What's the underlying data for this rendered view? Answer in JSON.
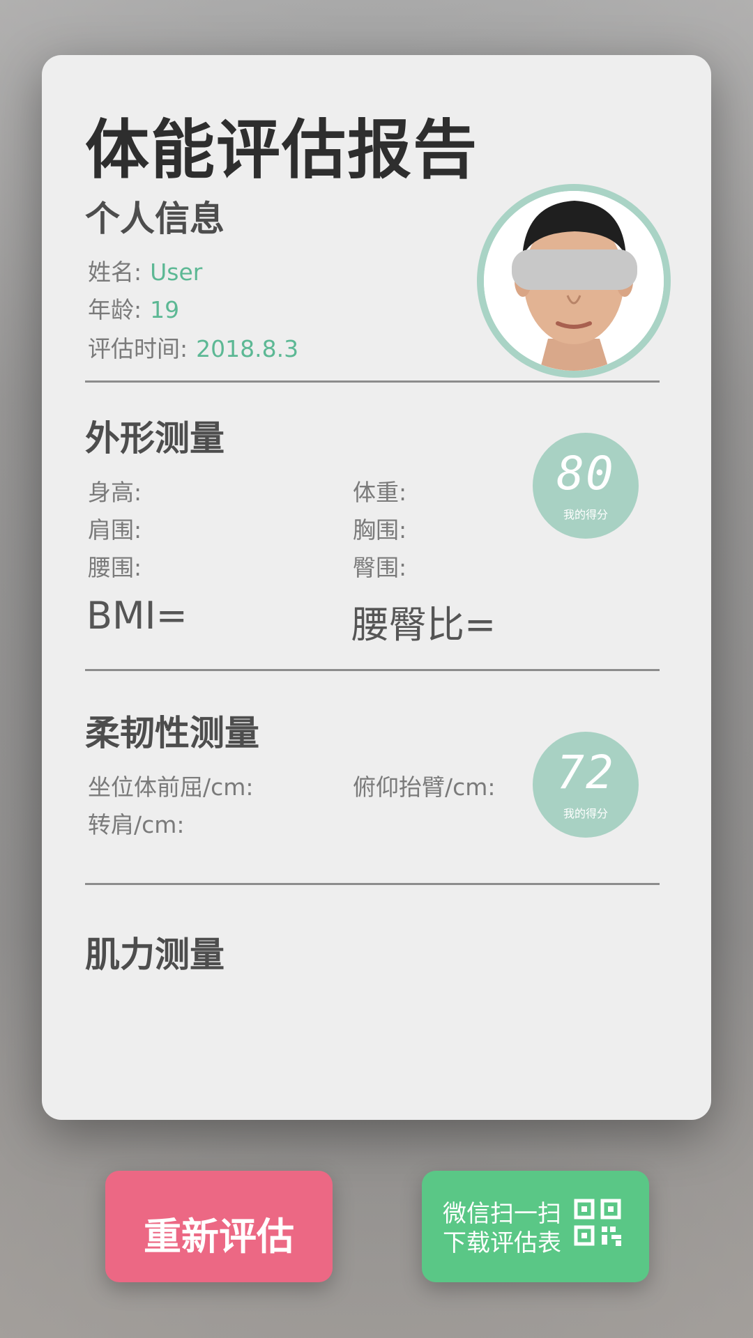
{
  "report": {
    "title": "体能评估报告"
  },
  "personal": {
    "heading": "个人信息",
    "name_label": "姓名:",
    "name_value": "User",
    "age_label": "年龄:",
    "age_value": "19",
    "time_label": "评估时间:",
    "time_value": "2018.8.3"
  },
  "shape": {
    "heading": "外形测量",
    "height_label": "身高:",
    "weight_label": "体重:",
    "shoulder_label": "肩围:",
    "chest_label": "胸围:",
    "waist_label": "腰围:",
    "hip_label": "臀围:",
    "bmi_label": "BMI=",
    "whr_label": "腰臀比=",
    "score": "80",
    "score_label": "我的得分"
  },
  "flex": {
    "heading": "柔韧性测量",
    "sit_reach_label": "坐位体前屈/cm:",
    "prone_arm_label": "俯仰抬臂/cm:",
    "shoulder_turn_label": "转肩/cm:",
    "score": "72",
    "score_label": "我的得分"
  },
  "strength": {
    "heading": "肌力测量"
  },
  "buttons": {
    "restart_label": "重新评估",
    "wechat_line1": "微信扫一扫",
    "wechat_line2": "下载评估表"
  },
  "icons": {
    "avatar": "user-photo",
    "qr": "qr-code-icon"
  },
  "colors": {
    "accent_green": "#5cb894",
    "score_circle": "#a8d1c3",
    "restart_button": "#ec6884",
    "wechat_button": "#5ac786"
  }
}
